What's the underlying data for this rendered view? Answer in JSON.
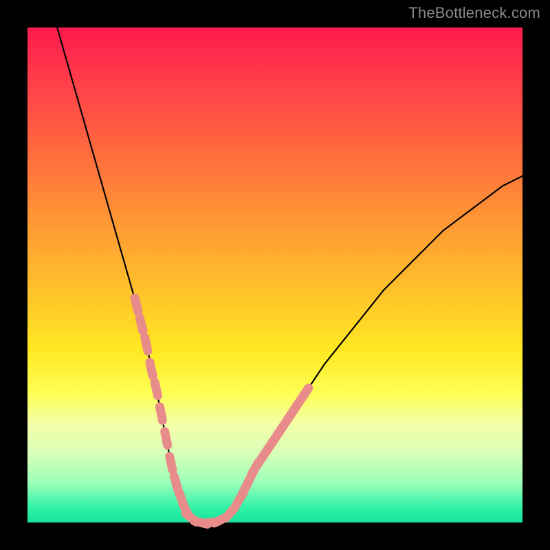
{
  "watermark": "TheBottleneck.com",
  "colors": {
    "curve_stroke": "#000000",
    "marker_fill": "#e88b8b",
    "marker_stroke": "#d97b7b"
  },
  "chart_data": {
    "type": "line",
    "title": "",
    "xlabel": "",
    "ylabel": "",
    "xlim": [
      0,
      100
    ],
    "ylim": [
      0,
      100
    ],
    "series": [
      {
        "name": "bottleneck-curve",
        "x": [
          6,
          8,
          10,
          12,
          14,
          16,
          18,
          20,
          22,
          24,
          26,
          27,
          28,
          29,
          30,
          31,
          32,
          33,
          35,
          37,
          39,
          41,
          43,
          45,
          48,
          52,
          56,
          60,
          64,
          68,
          72,
          76,
          80,
          84,
          88,
          92,
          96,
          100
        ],
        "y": [
          100,
          93,
          86,
          79,
          72,
          65,
          58,
          51,
          44,
          36,
          27,
          22,
          17,
          12,
          8,
          5,
          2.5,
          1,
          0,
          0,
          0.5,
          2,
          5,
          9,
          14,
          20,
          26,
          32,
          37,
          42,
          47,
          51,
          55,
          59,
          62,
          65,
          68,
          70
        ]
      }
    ],
    "markers": {
      "name": "highlighted-points",
      "points": [
        {
          "x": 22,
          "y": 44
        },
        {
          "x": 23,
          "y": 40
        },
        {
          "x": 24,
          "y": 36
        },
        {
          "x": 25,
          "y": 31
        },
        {
          "x": 26,
          "y": 27
        },
        {
          "x": 27,
          "y": 22
        },
        {
          "x": 28,
          "y": 17
        },
        {
          "x": 29,
          "y": 12
        },
        {
          "x": 30,
          "y": 8
        },
        {
          "x": 31,
          "y": 5
        },
        {
          "x": 32,
          "y": 2.5
        },
        {
          "x": 33,
          "y": 1
        },
        {
          "x": 35,
          "y": 0
        },
        {
          "x": 37,
          "y": 0
        },
        {
          "x": 39,
          "y": 0.5
        },
        {
          "x": 41,
          "y": 2
        },
        {
          "x": 43,
          "y": 5
        },
        {
          "x": 44,
          "y": 7
        },
        {
          "x": 45,
          "y": 9
        },
        {
          "x": 46,
          "y": 11
        },
        {
          "x": 47,
          "y": 12.5
        },
        {
          "x": 48,
          "y": 14
        },
        {
          "x": 49,
          "y": 15.5
        },
        {
          "x": 50,
          "y": 17
        },
        {
          "x": 51,
          "y": 18.5
        },
        {
          "x": 52,
          "y": 20
        },
        {
          "x": 53,
          "y": 21.5
        },
        {
          "x": 54,
          "y": 23
        },
        {
          "x": 55,
          "y": 24.5
        },
        {
          "x": 56,
          "y": 26
        }
      ]
    }
  }
}
